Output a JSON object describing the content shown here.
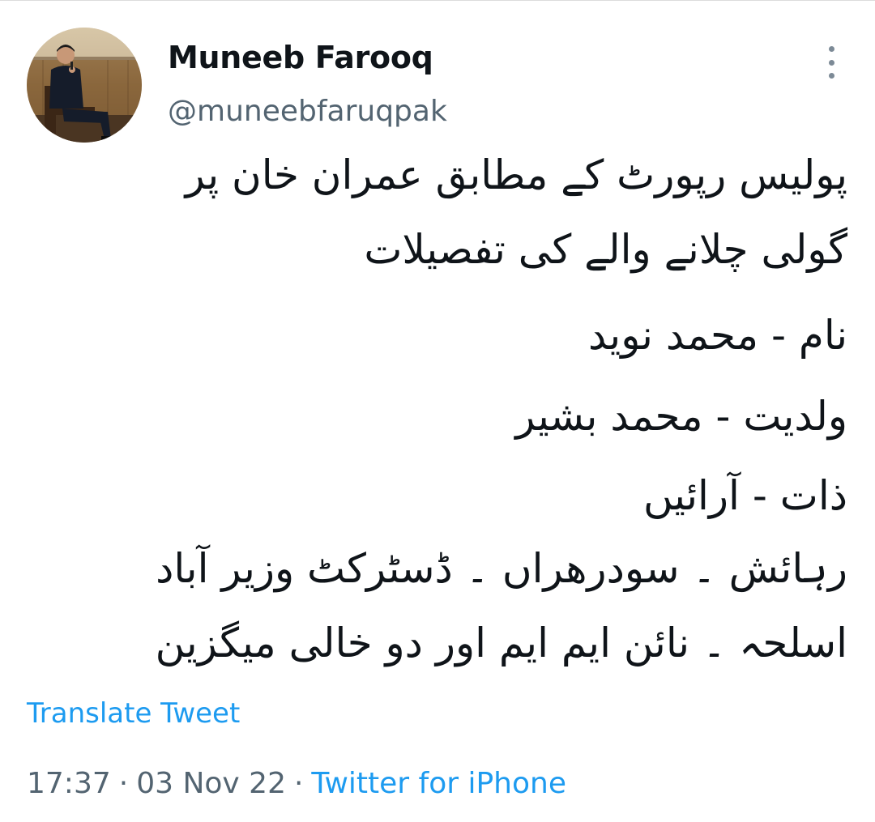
{
  "author": {
    "name": "Muneeb Farooq",
    "handle": "@muneebfaruqpak"
  },
  "tweet": {
    "lines": [
      "پولیس رپورٹ کے مطابق عمران خان پر",
      "گولی چلانے والے کی تفصیلات",
      "نام - محمد نوید",
      "ولدیت - محمد بشیر",
      "ذات - آرائیں",
      "رہائش ۔ سودرھراں ۔ ڈسٹرکٹ وزیر آباد",
      "اسلحہ ۔ نائن ایم ایم اور دو خالی میگزین"
    ],
    "translate_label": "Translate Tweet",
    "time": "17:37",
    "date": "03 Nov 22",
    "source": "Twitter for iPhone",
    "separator": "·"
  },
  "icons": {
    "more": "more-vertical-icon",
    "avatar": "profile-photo"
  },
  "colors": {
    "link": "#1d9bf0",
    "secondary_text": "#536471",
    "primary_text": "#0f1419",
    "background": "#ffffff"
  }
}
